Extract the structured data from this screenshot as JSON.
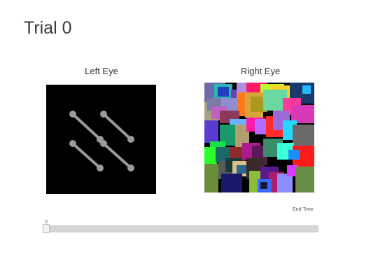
{
  "trial": {
    "title": "Trial 0"
  },
  "left_eye": {
    "label": "Left Eye",
    "stimulus": "four gray bone-shaped bars on black"
  },
  "right_eye": {
    "label": "Right Eye",
    "stimulus": "colorful overlapping squares mask on black"
  },
  "timeline": {
    "min_label": "0",
    "end_label": "End Time",
    "position": 0
  },
  "colors": {
    "background": "#ffffff",
    "panel": "#000000",
    "bars": "#9a9a9a",
    "track": "#d6d6d6"
  }
}
